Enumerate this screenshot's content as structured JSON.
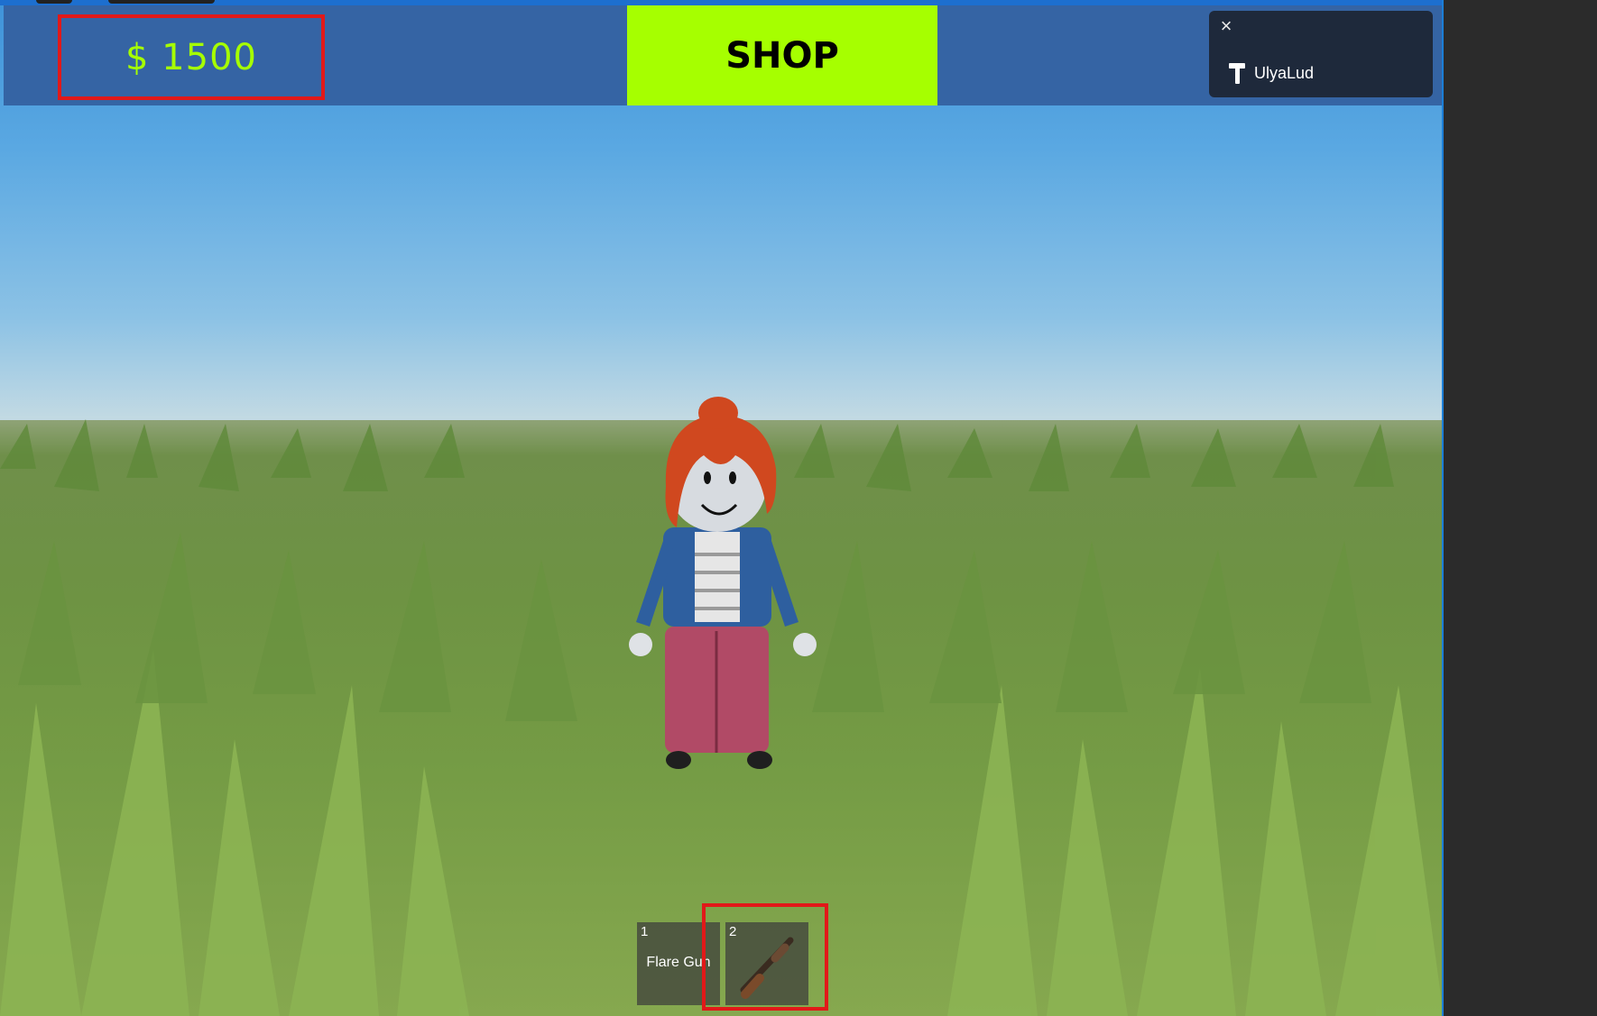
{
  "hud": {
    "money_label": "$ 1500",
    "shop_label": "SHOP"
  },
  "notification": {
    "close_symbol": "×",
    "username": "UlyaLud",
    "tool_icon": "hammer-icon"
  },
  "hotbar": {
    "slots": [
      {
        "number": "1",
        "label": "Flare Gun"
      },
      {
        "number": "2",
        "label": "",
        "icon": "shotgun-icon"
      }
    ]
  },
  "colors": {
    "accent": "#a6ff00",
    "topbar": "#3564a4",
    "highlight": "#e11919"
  }
}
